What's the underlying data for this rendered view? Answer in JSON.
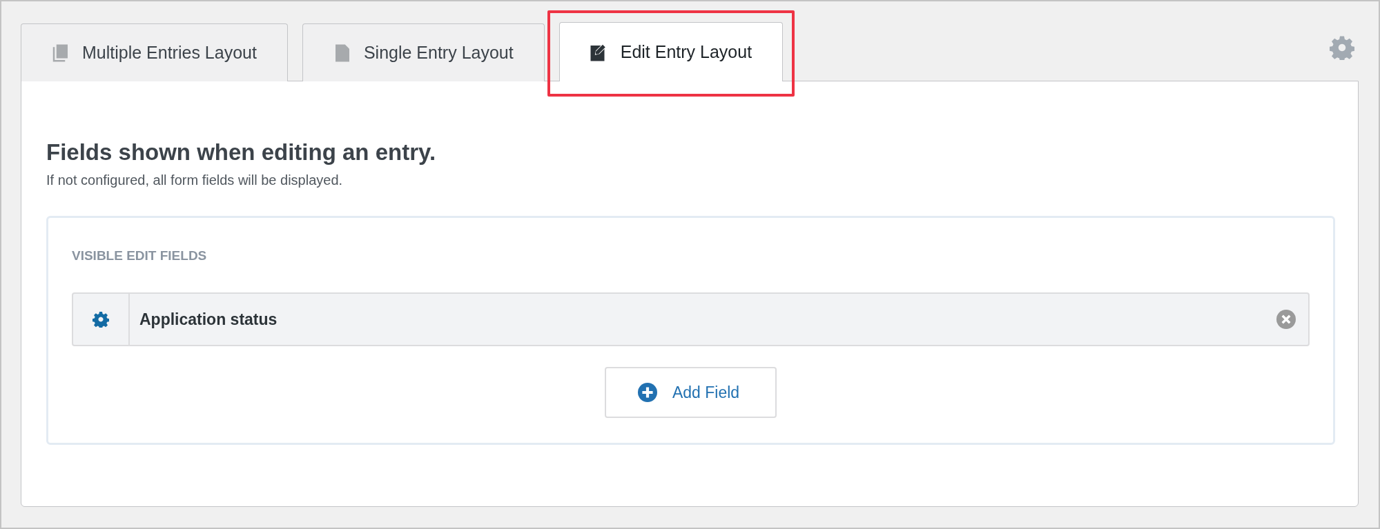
{
  "tabs": [
    {
      "label": "Multiple Entries Layout",
      "kind": "multiple",
      "selected": false,
      "highlighted": false
    },
    {
      "label": "Single Entry Layout",
      "kind": "single",
      "selected": false,
      "highlighted": false
    },
    {
      "label": "Edit Entry Layout",
      "kind": "edit",
      "selected": true,
      "highlighted": true
    }
  ],
  "heading": "Fields shown when editing an entry.",
  "description": "If not configured, all form fields will be displayed.",
  "section": {
    "title": "VISIBLE EDIT FIELDS",
    "fields": [
      {
        "label": "Application status"
      }
    ],
    "add_button": "Add Field"
  }
}
